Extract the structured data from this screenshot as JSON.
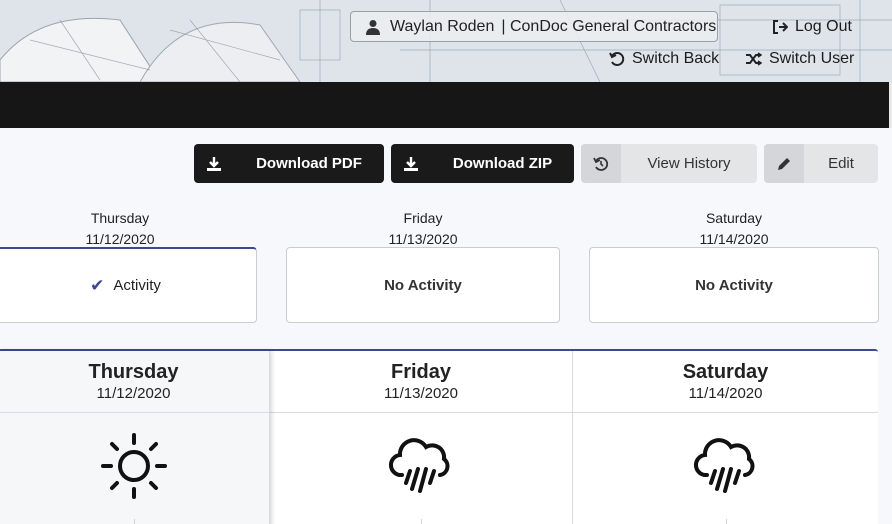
{
  "header": {
    "user_name": "Waylan Roden",
    "company": "| ConDoc General Contractors",
    "logout_label": "Log Out",
    "switch_back_label": "Switch Back",
    "switch_user_label": "Switch User"
  },
  "toolbar": {
    "download_pdf": "Download PDF",
    "download_zip": "Download ZIP",
    "view_history": "View History",
    "edit": "Edit"
  },
  "days": [
    {
      "day": "Thursday",
      "date": "11/12/2020",
      "activity": "Activity",
      "has_activity": true,
      "weather_icon": "sun-icon"
    },
    {
      "day": "Friday",
      "date": "11/13/2020",
      "activity": "No Activity",
      "has_activity": false,
      "weather_icon": "rain-cloud-icon"
    },
    {
      "day": "Saturday",
      "date": "11/14/2020",
      "activity": "No Activity",
      "has_activity": false,
      "weather_icon": "rain-cloud-icon"
    }
  ],
  "colors": {
    "accent": "#3b4a8a",
    "dark_button": "#1a1a1a",
    "light_button": "#e4e5e7"
  }
}
